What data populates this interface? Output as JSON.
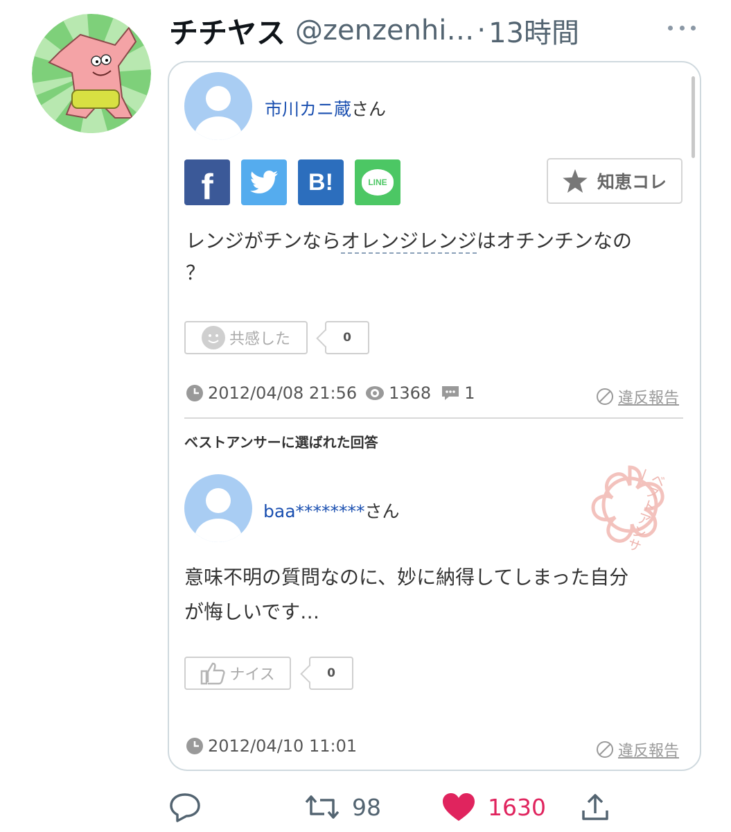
{
  "tweet": {
    "display_name": "チチヤス",
    "handle": "@zenzenhi…",
    "separator": "·",
    "time": "13時間",
    "replies": "",
    "retweets": "98",
    "likes": "1630"
  },
  "card": {
    "question": {
      "user_name_link": "市川カニ蔵",
      "user_suffix": "さん",
      "chiebukuro_btn": "知恵コレ",
      "text_part1": "レンジがチンなら",
      "text_link": "オレンジレンジ",
      "text_part2": "はオチンチンなの",
      "text_part3": "？",
      "empathy_label": "共感した",
      "empathy_count": "0",
      "date": "2012/04/08 21:56",
      "views": "1368",
      "answers": "1",
      "report": "違反報告"
    },
    "best_answer_label": "ベストアンサーに選ばれた回答",
    "best_answer_stamp": "ベストアンサー",
    "answer": {
      "user_name_link": "baa********",
      "user_suffix": "さん",
      "text_line1": "意味不明の質問なのに、妙に納得してしまった自分",
      "text_line2": "が悔しいです…",
      "nice_label": "ナイス",
      "nice_count": "0",
      "date": "2012/04/10 11:01",
      "report": "違反報告"
    },
    "share_buttons": [
      {
        "name": "facebook",
        "label": "f",
        "color": "#3b5998"
      },
      {
        "name": "twitter",
        "label": "",
        "color": "#55acee"
      },
      {
        "name": "hatena",
        "label": "B!",
        "color": "#2c6ebd"
      },
      {
        "name": "line",
        "label": "LINE",
        "color": "#4cc764"
      }
    ]
  },
  "icons": {
    "reply": "reply-icon",
    "retweet": "retweet-icon",
    "like": "heart-icon",
    "share": "share-icon",
    "more": "more-icon"
  }
}
